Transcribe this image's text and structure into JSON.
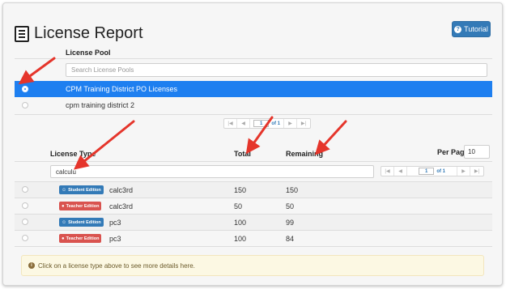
{
  "page": {
    "title": "License Report"
  },
  "tutorial": {
    "label": "Tutorial"
  },
  "license_pool": {
    "header": "License Pool",
    "search_placeholder": "Search License Pools",
    "rows": [
      {
        "name": "CPM Training District PO Licenses",
        "selected": true
      },
      {
        "name": "cpm training district 2",
        "selected": false
      }
    ],
    "pager": {
      "first": "|◀",
      "prev": "◀",
      "page": "1",
      "of": "of 1",
      "next": "▶",
      "last": "▶|"
    }
  },
  "license_types": {
    "col_type": "License Type",
    "col_total": "Total",
    "col_remaining": "Remaining",
    "per_page_label": "Per Page:",
    "per_page_value": "10",
    "search_value": "calculu",
    "pager": {
      "first": "|◀",
      "prev": "◀",
      "page": "1",
      "of": "of 1",
      "next": "▶",
      "last": "▶|"
    },
    "rows": [
      {
        "edition": "Student Edition",
        "kind": "student",
        "name": "calc3rd",
        "total": "150",
        "remaining": "150"
      },
      {
        "edition": "Teacher Edition",
        "kind": "teacher",
        "name": "calc3rd",
        "total": "50",
        "remaining": "50"
      },
      {
        "edition": "Student Edition",
        "kind": "student",
        "name": "pc3",
        "total": "100",
        "remaining": "99"
      },
      {
        "edition": "Teacher Edition",
        "kind": "teacher",
        "name": "pc3",
        "total": "100",
        "remaining": "84"
      }
    ]
  },
  "alert": {
    "text": "Click on a license type above to see more details here."
  },
  "colors": {
    "primary": "#337ab7",
    "selected_row": "#1e7ff0",
    "teacher_badge": "#d9534f",
    "annotation_arrow": "#e5352b",
    "alert_bg": "#fcf8e3"
  },
  "icons": {
    "title": "list-report-icon",
    "tutorial": "question-circle-icon",
    "student": "user-icon",
    "teacher": "apple-icon",
    "alert": "info-circle-icon"
  }
}
